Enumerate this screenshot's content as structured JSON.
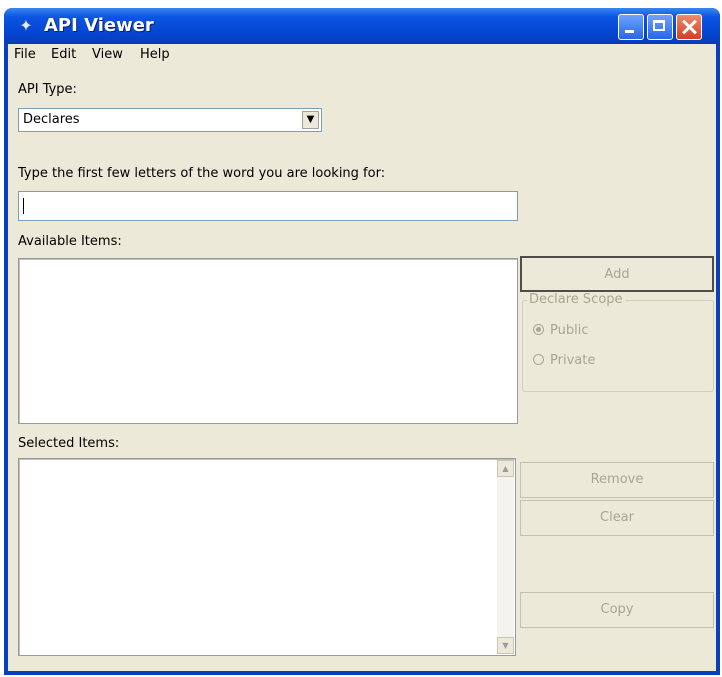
{
  "window": {
    "title": "API Viewer"
  },
  "menu": [
    "File",
    "Edit",
    "View",
    "Help"
  ],
  "api_type": {
    "label": "API Type:",
    "value": "Declares"
  },
  "search": {
    "label": "Type the first few letters of the word you are looking for:",
    "value": ""
  },
  "available": {
    "label": "Available Items:"
  },
  "selected": {
    "label": "Selected Items:"
  },
  "buttons": {
    "add": "Add",
    "remove": "Remove",
    "clear": "Clear",
    "copy": "Copy"
  },
  "declare_scope": {
    "title": "Declare Scope",
    "public": "Public",
    "private": "Private",
    "selected": "Public"
  }
}
